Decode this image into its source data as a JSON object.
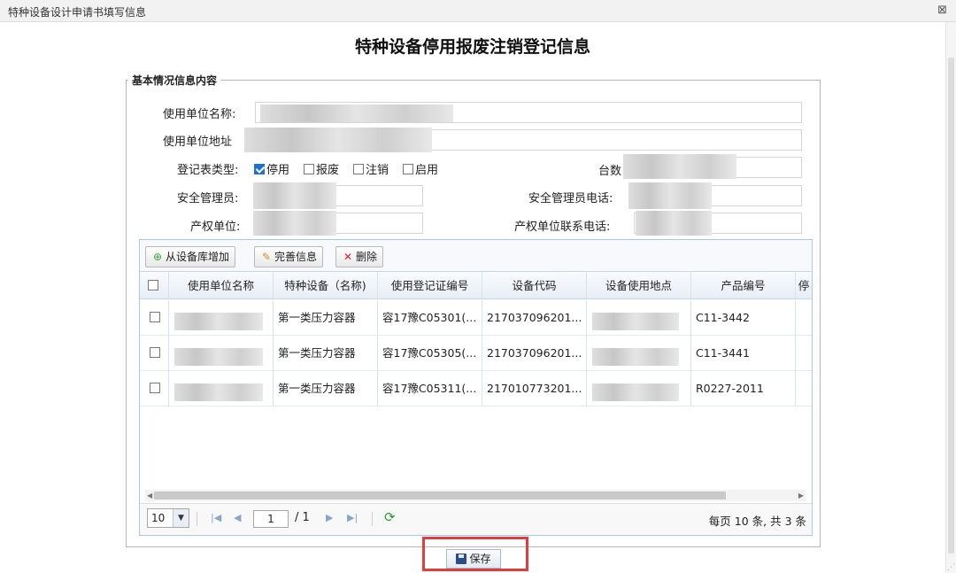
{
  "window": {
    "title": "特种设备设计申请书填写信息",
    "close_icon": "⊠"
  },
  "page": {
    "title": "特种设备停用报废注销登记信息"
  },
  "basic": {
    "legend": "基本情况信息内容",
    "fields": {
      "unit_name": "使用单位名称:",
      "unit_address": "使用单位地址",
      "form_type": "登记表类型:",
      "count": "台数",
      "safety_manager": "安全管理员:",
      "safety_phone": "安全管理员电话:",
      "owner": "产权单位:",
      "owner_phone": "产权单位联系电话:"
    },
    "form_types": [
      {
        "label": "停用",
        "checked": true
      },
      {
        "label": "报废",
        "checked": false
      },
      {
        "label": "注销",
        "checked": false
      },
      {
        "label": "启用",
        "checked": false
      }
    ]
  },
  "grid": {
    "toolbar": {
      "add": "从设备库增加",
      "complete": "完善信息",
      "delete": "删除"
    },
    "columns": [
      "使用单位名称",
      "特种设备（名称)",
      "使用登记证编号",
      "设备代码",
      "设备使用地点",
      "产品编号",
      "停"
    ],
    "rows": [
      {
        "equipment": "第一类压力容器",
        "cert": "容17豫C05301(...",
        "code": "217037096201...",
        "product": "C11-3442"
      },
      {
        "equipment": "第一类压力容器",
        "cert": "容17豫C05305(...",
        "code": "217037096201...",
        "product": "C11-3441"
      },
      {
        "equipment": "第一类压力容器",
        "cert": "容17豫C05311(...",
        "code": "217010773201...",
        "product": "R0227-2011"
      }
    ],
    "pager": {
      "page_size": "10",
      "current": "1",
      "total": "/ 1",
      "info": "每页 10 条, 共 3 条"
    }
  },
  "actions": {
    "save": "保存"
  },
  "colors": {
    "highlight": "#e03d3d",
    "accent": "#1e72cc",
    "grid_border": "#a9c8e6"
  }
}
